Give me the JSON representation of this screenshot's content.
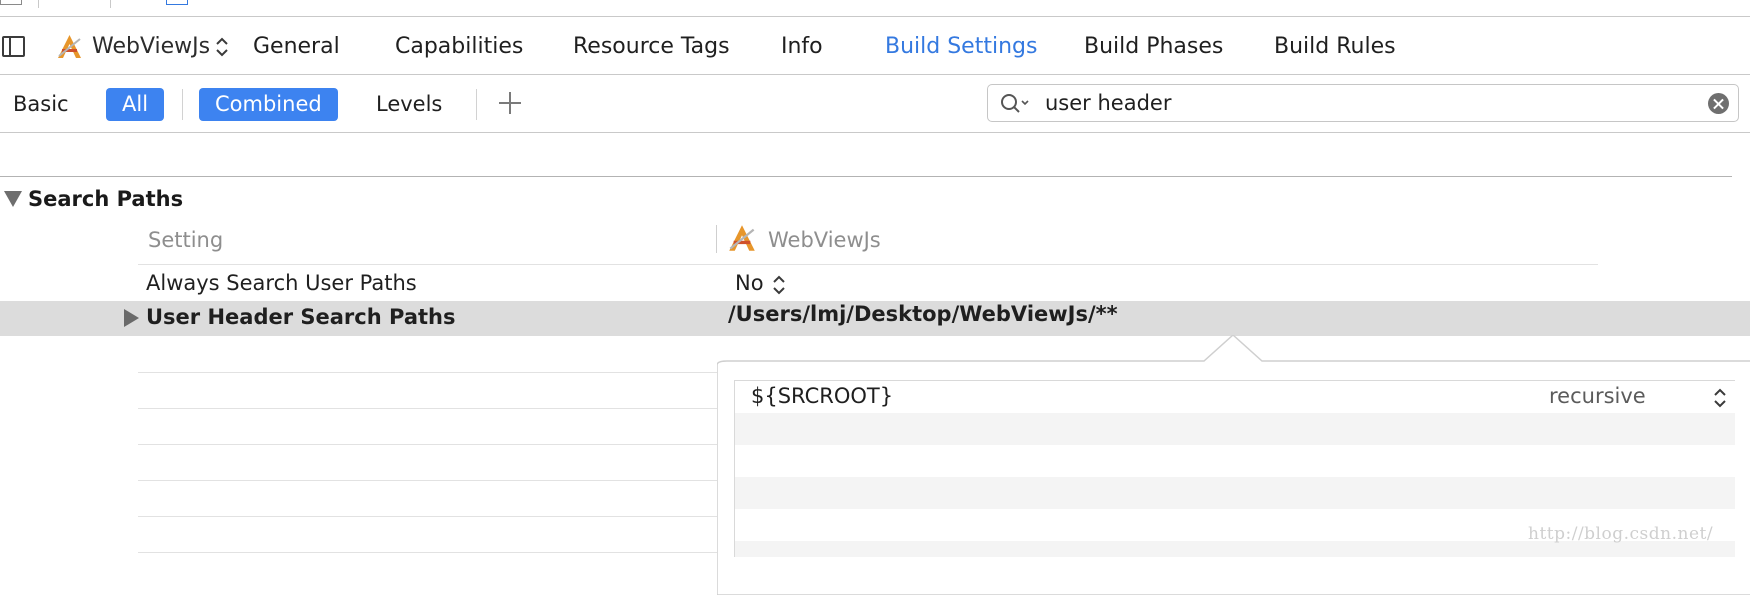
{
  "project": {
    "target_name": "WebViewJs"
  },
  "tabs": [
    {
      "label": "General",
      "active": false
    },
    {
      "label": "Capabilities",
      "active": false
    },
    {
      "label": "Resource Tags",
      "active": false
    },
    {
      "label": "Info",
      "active": false
    },
    {
      "label": "Build Settings",
      "active": true
    },
    {
      "label": "Build Phases",
      "active": false
    },
    {
      "label": "Build Rules",
      "active": false
    }
  ],
  "filter": {
    "basic": "Basic",
    "all": "All",
    "combined": "Combined",
    "levels": "Levels",
    "add_icon": "plus-icon"
  },
  "search": {
    "value": "user header",
    "icon": "magnifier-dropdown-icon",
    "clear_icon": "clear-circle-icon"
  },
  "section": {
    "title": "Search Paths",
    "columns": {
      "setting": "Setting",
      "target": "WebViewJs"
    },
    "rows": [
      {
        "label": "Always Search User Paths",
        "value": "No"
      },
      {
        "label": "User Header Search Paths",
        "value": "/Users/lmj/Desktop/WebViewJs/**"
      }
    ]
  },
  "popover": {
    "items": [
      {
        "path": "${SRCROOT}",
        "mode": "recursive"
      }
    ]
  },
  "watermark": "http://blog.csdn.net/",
  "colors": {
    "accent": "#3479e0",
    "pill": "#3d83f0",
    "selected_row": "#dcdcdc"
  }
}
